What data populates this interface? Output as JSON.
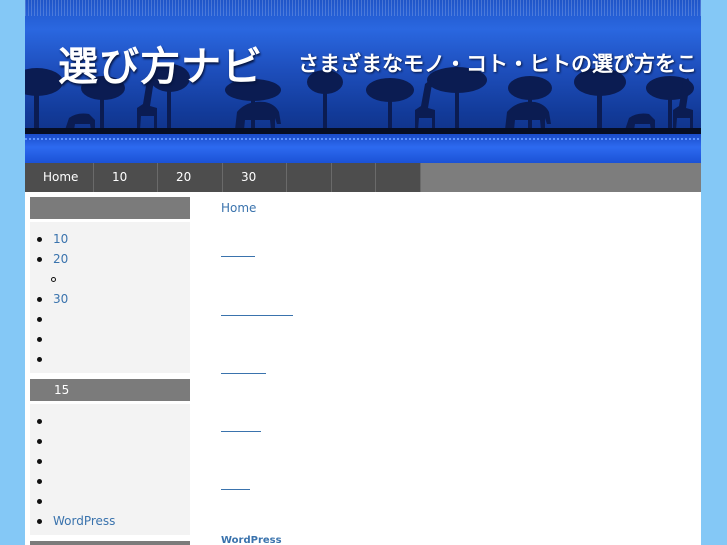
{
  "header": {
    "site_title": "選び方ナビ",
    "site_description": "さまざまなモノ・コト・ヒトの選び方をこ"
  },
  "nav": {
    "items": [
      {
        "label": "Home"
      },
      {
        "label": "10"
      },
      {
        "label": "20"
      },
      {
        "label": "30"
      },
      {
        "label": ""
      },
      {
        "label": ""
      },
      {
        "label": ""
      }
    ]
  },
  "sidebar": {
    "widget1": {
      "title": "",
      "items": [
        {
          "label": "10"
        },
        {
          "label": "20"
        },
        {
          "label": "",
          "sub": true
        },
        {
          "label": "30"
        },
        {
          "label": ""
        },
        {
          "label": ""
        },
        {
          "label": ""
        }
      ]
    },
    "widget2": {
      "title": "15",
      "items": [
        {
          "label": ""
        },
        {
          "label": ""
        },
        {
          "label": ""
        },
        {
          "label": ""
        },
        {
          "label": ""
        },
        {
          "label": "WordPress"
        }
      ]
    },
    "widget3": {
      "title": ""
    }
  },
  "main": {
    "breadcrumb": "Home",
    "footer_label": "WordPress"
  },
  "colors": {
    "page_background": "#84c8f6",
    "link": "#3a73ad",
    "nav_item": "#4d4d4d",
    "nav_bar": "#7d7d7d",
    "widget_title": "#7b7b7b"
  }
}
